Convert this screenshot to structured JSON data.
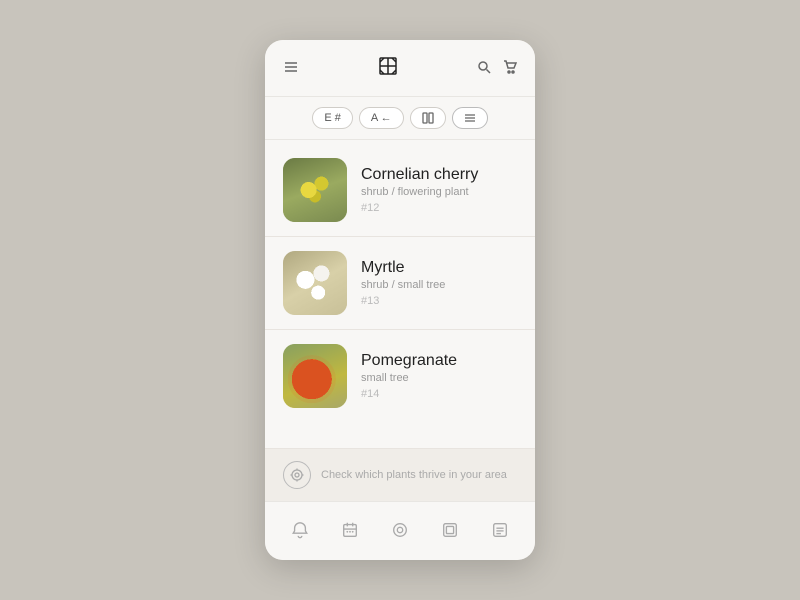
{
  "header": {
    "logo": "✦",
    "menu_label": "menu",
    "search_label": "search",
    "cart_label": "cart"
  },
  "filters": [
    {
      "id": "filter-e",
      "label": "E #",
      "active": false
    },
    {
      "id": "filter-a",
      "label": "A ←",
      "active": false
    },
    {
      "id": "filter-grid",
      "label": "grid",
      "active": false
    },
    {
      "id": "filter-list",
      "label": "list",
      "active": true
    }
  ],
  "plants": [
    {
      "name": "Cornelian cherry",
      "type": "shrub / flowering plant",
      "number": "#12",
      "thumb_class": "thumb-cornelian"
    },
    {
      "name": "Myrtle",
      "type": "shrub / small tree",
      "number": "#13",
      "thumb_class": "thumb-myrtle"
    },
    {
      "name": "Pomegranate",
      "type": "small tree",
      "number": "#14",
      "thumb_class": "thumb-pomegranate"
    }
  ],
  "location_banner": {
    "text": "Check which plants thrive in your area"
  },
  "bottom_nav": [
    {
      "id": "nav-bell",
      "label": "notifications"
    },
    {
      "id": "nav-calendar",
      "label": "calendar"
    },
    {
      "id": "nav-circle",
      "label": "home"
    },
    {
      "id": "nav-box",
      "label": "collection"
    },
    {
      "id": "nav-list",
      "label": "list"
    }
  ]
}
